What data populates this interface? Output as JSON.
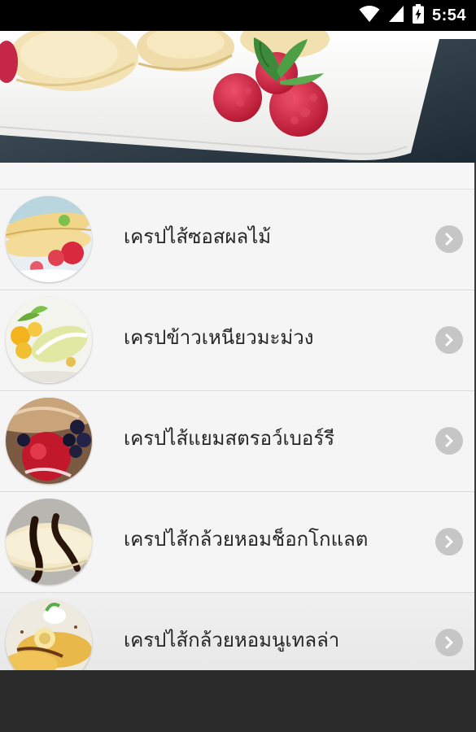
{
  "status_bar": {
    "time": "5:54",
    "icons": [
      "wifi-icon",
      "cell-signal-icon",
      "battery-charging-icon"
    ]
  },
  "hero": {
    "image": "crepes-with-raspberries-photo"
  },
  "menu": {
    "items": [
      {
        "label": "เครปไส้ซอสผลไม้",
        "thumb": "crepe-fruit-sauce-thumbnail"
      },
      {
        "label": "เครปข้าวเหนียวมะม่วง",
        "thumb": "crepe-mango-sticky-rice-thumbnail"
      },
      {
        "label": "เครปไส้แยมสตรอว์เบอร์รี",
        "thumb": "crepe-strawberry-jam-thumbnail"
      },
      {
        "label": "เครปไส้กล้วยหอมช็อกโกแลต",
        "thumb": "crepe-banana-chocolate-thumbnail"
      },
      {
        "label": "เครปไส้กล้วยหอมนูเทลล่า",
        "thumb": "crepe-banana-nutella-thumbnail"
      }
    ],
    "chevron_icon": "chevron-right-icon"
  },
  "colors": {
    "status_bar": "#000000",
    "list_background": "#f5f5f5",
    "chevron": "#c6c6c6",
    "bottom_bar": "#2b2b2b",
    "text": "#262626"
  }
}
